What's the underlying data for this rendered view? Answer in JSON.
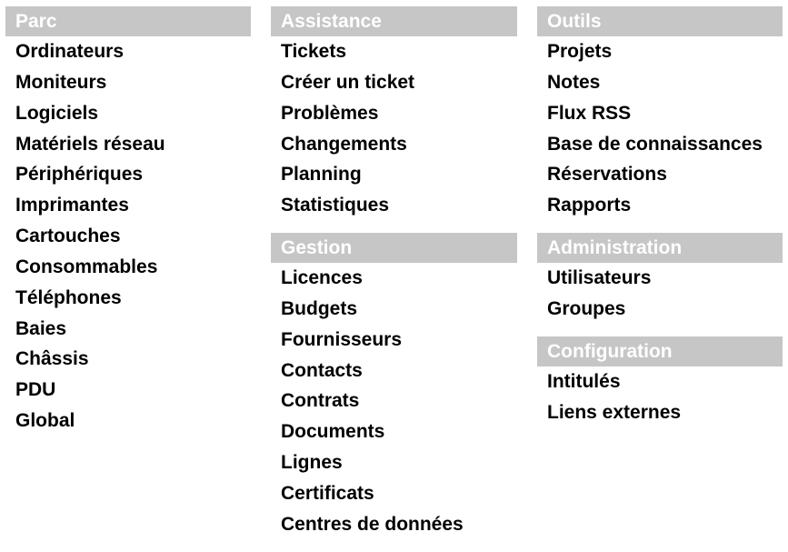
{
  "columns": [
    {
      "sections": [
        {
          "title": "Parc",
          "items": [
            "Ordinateurs",
            "Moniteurs",
            "Logiciels",
            "Matériels réseau",
            "Périphériques",
            "Imprimantes",
            "Cartouches",
            "Consommables",
            "Téléphones",
            "Baies",
            "Châssis",
            "PDU",
            "Global"
          ]
        }
      ]
    },
    {
      "sections": [
        {
          "title": "Assistance",
          "items": [
            "Tickets",
            "Créer un ticket",
            "Problèmes",
            "Changements",
            "Planning",
            "Statistiques"
          ]
        },
        {
          "title": "Gestion",
          "items": [
            "Licences",
            "Budgets",
            "Fournisseurs",
            "Contacts",
            "Contrats",
            "Documents",
            "Lignes",
            "Certificats",
            "Centres de données"
          ]
        }
      ]
    },
    {
      "sections": [
        {
          "title": "Outils",
          "items": [
            "Projets",
            "Notes",
            "Flux RSS",
            "Base de connaissances",
            "Réservations",
            "Rapports"
          ]
        },
        {
          "title": "Administration",
          "items": [
            "Utilisateurs",
            "Groupes"
          ]
        },
        {
          "title": "Configuration",
          "items": [
            "Intitulés",
            "Liens externes"
          ]
        }
      ]
    }
  ]
}
